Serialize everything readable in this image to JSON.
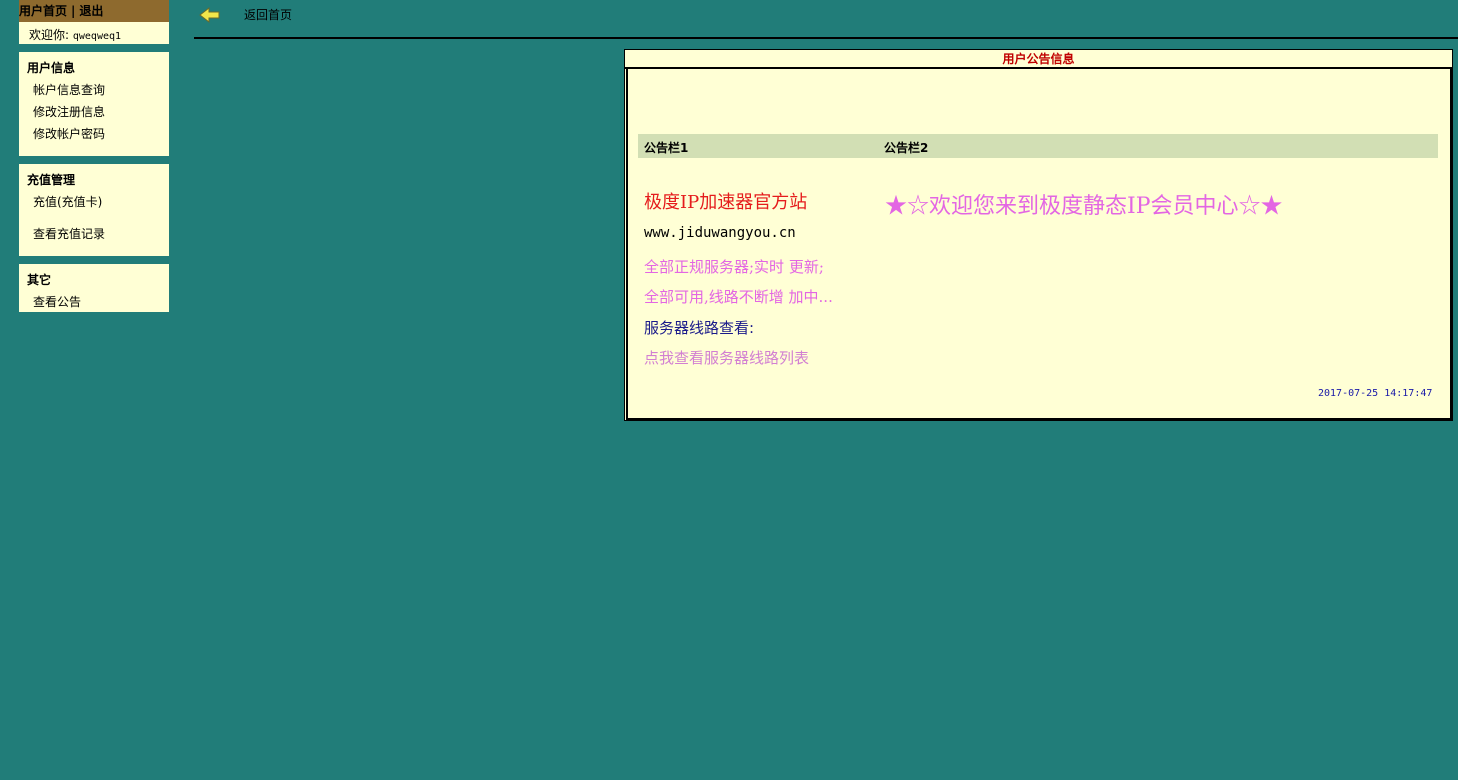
{
  "sidebar": {
    "header": {
      "home": "用户首页",
      "separator": "|",
      "logout": "退出"
    },
    "welcome": {
      "label": "欢迎你:",
      "username": "qweqweq1"
    },
    "sections": [
      {
        "title": "用户信息",
        "items": [
          "帐户信息查询",
          "修改注册信息",
          "修改帐户密码"
        ]
      },
      {
        "title": "充值管理",
        "items": [
          "充值(充值卡)",
          "查看充值记录"
        ]
      },
      {
        "title": "其它",
        "items": [
          "查看公告"
        ]
      }
    ]
  },
  "topbar": {
    "back_label": "返回首页",
    "back_icon": "arrow-left-icon"
  },
  "notice": {
    "title": "用户公告信息",
    "col1_header": "公告栏1",
    "col2_header": "公告栏2",
    "site_name": "极度IP加速器官方站",
    "url": "www.jiduwangyou.cn",
    "line1": "全部正规服务器;实时 更新;",
    "line2": "全部可用,线路不断增 加中...",
    "servers_label": "服务器线路查看:",
    "server_list_link": "点我查看服务器线路列表",
    "welcome": "★☆欢迎您来到极度静态IP会员中心☆★",
    "date": "2017-07-25 14:17:47"
  },
  "colors": {
    "background": "#217d79",
    "sidebar_header": "#8e6a2e",
    "panel_bg": "#ffffd5",
    "column_header": "#d2dfb4",
    "title_red": "#c00000",
    "pink": "#e366e3"
  }
}
